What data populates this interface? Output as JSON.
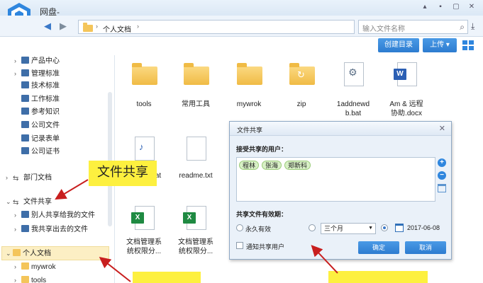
{
  "app": {
    "title": "网盘-"
  },
  "window_buttons": [
    "▴",
    "▪",
    "▢",
    "✕"
  ],
  "nav": {
    "back_icon": "back-arrow-icon",
    "forward_icon": "forward-arrow-icon",
    "path": "个人文档",
    "path_chevron": "›",
    "search_placeholder": "输入文件名称"
  },
  "toolbar": {
    "create_dir": "创建目录",
    "upload": "上传"
  },
  "sidebar": {
    "items": [
      {
        "label": "产品中心",
        "icon": "org-icon",
        "chevron": "›"
      },
      {
        "label": "管理标准",
        "icon": "doc-icon",
        "chevron": "›"
      },
      {
        "label": "技术标准",
        "icon": "gear-icon",
        "chevron": ""
      },
      {
        "label": "工作标准",
        "icon": "clock-icon",
        "chevron": ""
      },
      {
        "label": "参考知识",
        "icon": "doc-icon",
        "chevron": ""
      },
      {
        "label": "公司文件",
        "icon": "doc-icon",
        "chevron": ""
      },
      {
        "label": "记录表单",
        "icon": "list-icon",
        "chevron": ""
      },
      {
        "label": "公司证书",
        "icon": "cert-icon",
        "chevron": ""
      },
      {
        "label": "部门文档",
        "icon": "share-icon",
        "chevron": "›"
      },
      {
        "label": "文件共享",
        "icon": "share-icon",
        "chevron": "⌄"
      },
      {
        "label": "别人共享给我的文件",
        "icon": "doc-icon",
        "chevron": "›"
      },
      {
        "label": "我共享出去的文件",
        "icon": "doc-icon",
        "chevron": "›"
      },
      {
        "label": "个人文档",
        "icon": "folder-icon",
        "chevron": "⌄"
      },
      {
        "label": "mywrok",
        "icon": "folder-icon",
        "chevron": "›"
      },
      {
        "label": "tools",
        "icon": "folder-icon",
        "chevron": "›"
      }
    ]
  },
  "files": [
    {
      "name": "tools",
      "type": "folder"
    },
    {
      "name": "常用工具",
      "type": "folder"
    },
    {
      "name": "mywrok",
      "type": "folder"
    },
    {
      "name": "zip",
      "type": "folder-sync"
    },
    {
      "name": "1addnewd\nb.bat",
      "type": "bat"
    },
    {
      "name": "Am & 远程\n协助.docx",
      "type": "docx"
    },
    {
      "name": "at",
      "type": "audio"
    },
    {
      "name": "readme.txt",
      "type": "txt"
    },
    {
      "name": "文档管理系\n统权限分...",
      "type": "xlsx"
    },
    {
      "name": "文档管理系\n统权限分...",
      "type": "xlsx"
    }
  ],
  "dialog": {
    "title": "文件共享",
    "close": "✕",
    "users_label": "接受共享的用户：",
    "users": [
      "程林",
      "张海",
      "郑新科"
    ],
    "validity_label": "共享文件有效期：",
    "opt_forever": "永久有效",
    "opt_duration": "三个月",
    "opt_date": "2017-06-08",
    "notify": "通知共享用户",
    "ok": "确定",
    "cancel": "取消"
  },
  "callouts": {
    "file_share": "文件共享",
    "bottom_left": "",
    "bottom_right": ""
  },
  "colors": {
    "accent": "#2d7cd0",
    "callout": "#fdf03f",
    "arrow": "#c81e1e"
  }
}
